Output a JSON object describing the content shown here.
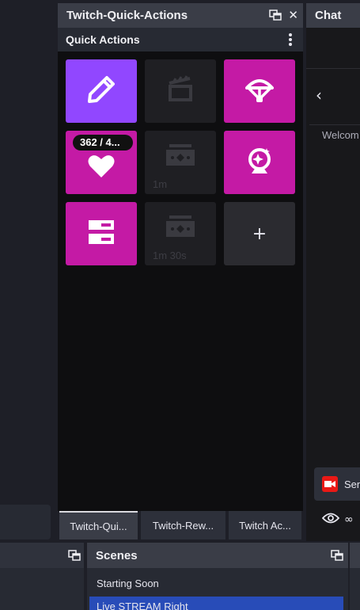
{
  "dock": {
    "title": "Twitch-Quick-Actions",
    "header_title": "Quick Actions",
    "tiles": [
      {
        "icon": "pencil-icon",
        "color": "#9147ff"
      },
      {
        "icon": "clapperboard-icon",
        "color": "#1f1f23"
      },
      {
        "icon": "parachute-icon",
        "color": "#c41aa5"
      },
      {
        "icon": "heart-icon",
        "color": "#c41aa5",
        "badge": "362 / 4..."
      },
      {
        "icon": "ticket-icon",
        "color": "#1f1f23",
        "cooldown": "1m"
      },
      {
        "icon": "sparkle-webcam-icon",
        "color": "#c41aa5"
      },
      {
        "icon": "layout-icon",
        "color": "#c41aa5"
      },
      {
        "icon": "ticket-icon",
        "color": "#1f1f23",
        "cooldown": "1m 30s"
      },
      {
        "icon": "plus-icon",
        "color": "#1f1f23",
        "label": "+"
      }
    ],
    "tabs": [
      "Twitch-Qui...",
      "Twitch-Rew...",
      "Twitch Ac..."
    ]
  },
  "chat": {
    "title": "Chat",
    "back": "‹",
    "welcome": "Welcom",
    "send_label": "Sen",
    "viewers": "∞"
  },
  "scenes": {
    "title": "Scenes",
    "items": [
      "Starting Soon",
      "Live STREAM Right"
    ]
  },
  "colors": {
    "accent_pink": "#c41aa5",
    "accent_purple": "#9147ff",
    "selected": "#284cb8"
  }
}
